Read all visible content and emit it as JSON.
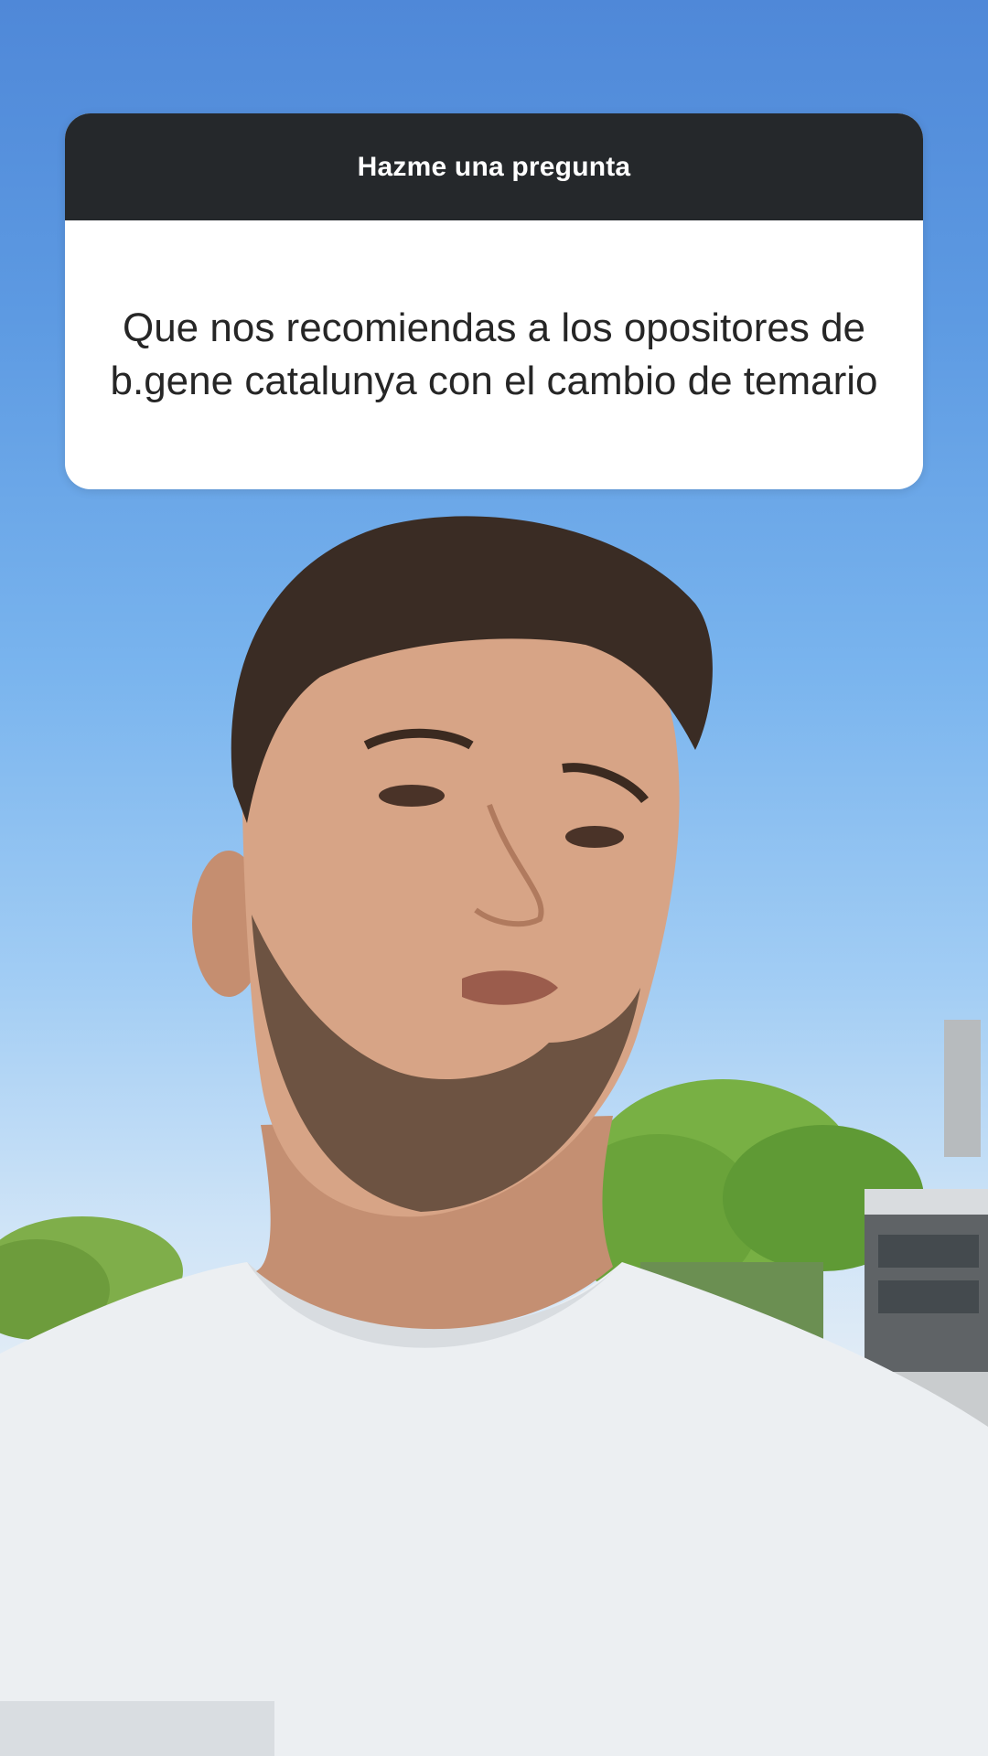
{
  "story": {
    "question_sticker": {
      "header": "Hazme una pregunta",
      "question": "Que nos recomiendas a los opositores de b.gene catalunya con el cambio de temario"
    }
  }
}
